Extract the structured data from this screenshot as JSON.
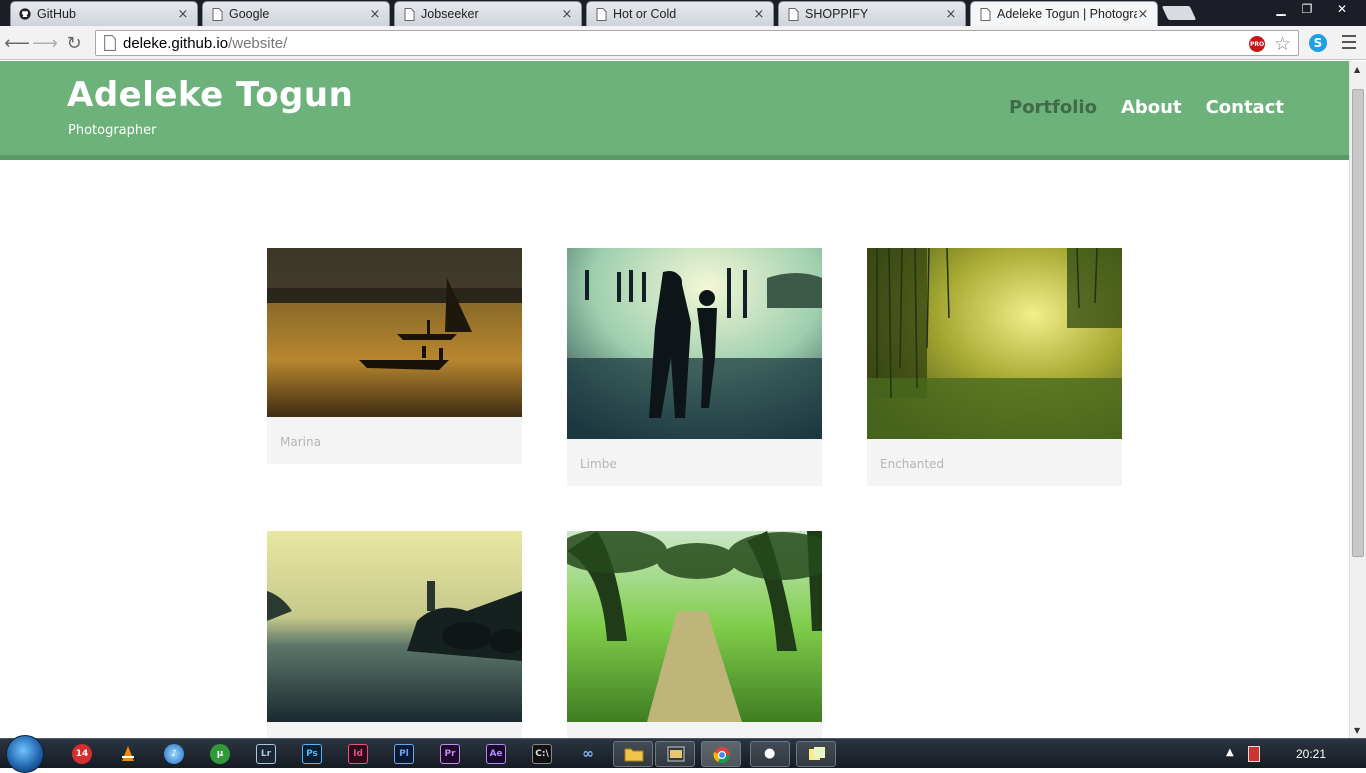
{
  "browser": {
    "tabs": [
      {
        "title": "GitHub",
        "icon": "github-icon"
      },
      {
        "title": "Google",
        "icon": "page-icon"
      },
      {
        "title": "Jobseeker",
        "icon": "page-icon"
      },
      {
        "title": "Hot or Cold",
        "icon": "page-icon"
      },
      {
        "title": "SHOPPIFY",
        "icon": "page-icon"
      },
      {
        "title": "Adeleke Togun | Photogra",
        "icon": "page-icon"
      }
    ],
    "url_host": "deleke.github.io",
    "url_path": "/website/",
    "pro_badge": "PRO",
    "skype_letter": "S"
  },
  "site": {
    "title": "Adeleke Togun",
    "subtitle": "Photographer",
    "nav": [
      {
        "label": "Portfolio",
        "current": true
      },
      {
        "label": "About",
        "current": false
      },
      {
        "label": "Contact",
        "current": false
      }
    ],
    "gallery": [
      {
        "caption": "Marina"
      },
      {
        "caption": "Limbe"
      },
      {
        "caption": "Enchanted"
      },
      {
        "caption": ""
      },
      {
        "caption": ""
      }
    ]
  },
  "taskbar": {
    "apps": [
      "14",
      "Lr",
      "Ps",
      "Id",
      "Pl",
      "Pr",
      "Ae"
    ],
    "clock": "20:21"
  },
  "colors": {
    "header": "#6cb27a",
    "nav_current": "#3f6b48",
    "tab_bar": "#1b1e26"
  }
}
